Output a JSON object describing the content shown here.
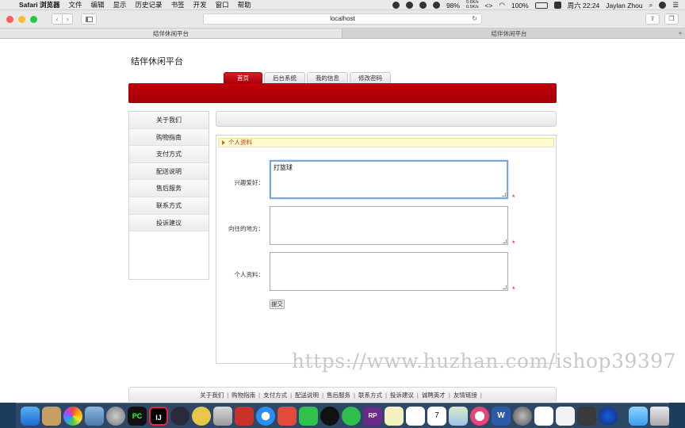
{
  "menubar": {
    "app": "Safari 浏览器",
    "items": [
      "文件",
      "编辑",
      "显示",
      "历史记录",
      "书签",
      "开发",
      "窗口",
      "帮助"
    ],
    "net_up": "0.6K/s",
    "net_down": "0.5K/s",
    "cpu": "98%",
    "battery": "100%",
    "datetime": "周六 22:24",
    "user": "Jaylan Zhou"
  },
  "browser": {
    "url": "localhost",
    "tabs": [
      "结伴休闲平台",
      "结伴休闲平台"
    ],
    "new_tab_label": "+"
  },
  "site": {
    "title": "结伴休闲平台",
    "nav": [
      "首页",
      "后台系统",
      "我的信息",
      "修改密码"
    ],
    "sidebar": [
      "关于我们",
      "购物指南",
      "支付方式",
      "配送说明",
      "售后服务",
      "联系方式",
      "投诉建议"
    ],
    "panel_title": "个人资料",
    "form": {
      "hobby_label": "兴趣爱好：",
      "hobby_value": "打篮球",
      "place_label": "向往的地方：",
      "place_value": "",
      "profile_label": "个人资料：",
      "profile_value": "",
      "required_mark": "*",
      "submit_label": "提交"
    },
    "footer_links": [
      "关于我们",
      "购物指南",
      "支付方式",
      "配送说明",
      "售后服务",
      "联系方式",
      "投诉建议",
      "诚聘英才",
      "友情链接"
    ],
    "footer_separator": "|"
  },
  "watermark": "https://www.huzhan.com/ishop39397",
  "dock": {
    "icons": [
      "finder-icon",
      "notes-icon",
      "photos-icon",
      "preview-icon",
      "launchpad-icon",
      "pycharm-icon",
      "intellij-icon",
      "sublime-icon",
      "cyberduck-icon",
      "sequel-icon",
      "redis-icon",
      "safari-icon",
      "remote-icon",
      "wechat-icon",
      "qq-icon",
      "music-app-icon",
      "axure-rp-icon",
      "stickies-icon",
      "reminders-icon",
      "calendar-icon",
      "maps-icon",
      "itunes-icon",
      "word-icon",
      "preferences-icon",
      "baidu-disk-icon",
      "textedit-icon",
      "sublime-text-icon",
      "browser-icon",
      "folder-icon",
      "trash-icon"
    ],
    "calendar_day": "7",
    "rp_label": "RP",
    "pc_label": "PC",
    "ij_label": "IJ",
    "w_label": "W"
  },
  "colors": {
    "brand_red": "#b30008",
    "panel_title_bg": "#fffbd1",
    "panel_title_text": "#c23a00",
    "desktop": "#1b3d5e"
  }
}
